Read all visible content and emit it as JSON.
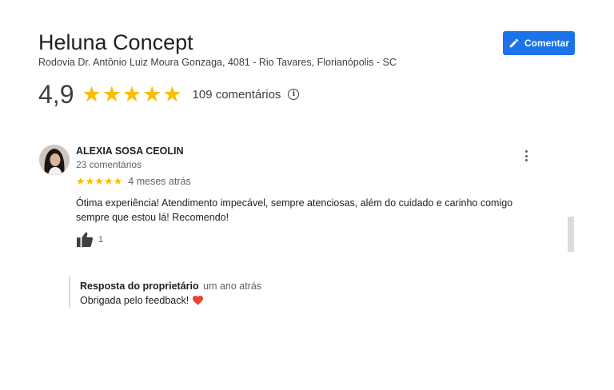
{
  "business": {
    "name": "Heluna Concept",
    "address": "Rodovia Dr. Antônio Luiz Moura Gonzaga, 4081 - Rio Tavares, Florianópolis - SC",
    "comment_button_label": "Comentar"
  },
  "rating": {
    "value": "4,9",
    "stars": "★★★★★",
    "count_label": "109 comentários",
    "info_glyph": "i"
  },
  "review": {
    "reviewer_name": "ALEXIA SOSA CEOLIN",
    "reviewer_count": "23 comentários",
    "stars": "★★★★★",
    "time": "4 meses atrás",
    "text": "Ótima experiência! Atendimento impecável, sempre atenciosas, além do cuidado e carinho comigo sempre que estou lá! Recomendo!",
    "like_count": "1"
  },
  "owner_response": {
    "label": "Resposta do proprietário",
    "time": "um ano atrás",
    "text": "Obrigada pelo feedback!"
  },
  "colors": {
    "accent": "#1a73e8",
    "star": "#fbbc04",
    "heart": "#ea4335"
  },
  "icons": [
    "pencil-icon",
    "info-icon",
    "more-vert-icon",
    "thumb-up-icon",
    "heart-icon"
  ]
}
